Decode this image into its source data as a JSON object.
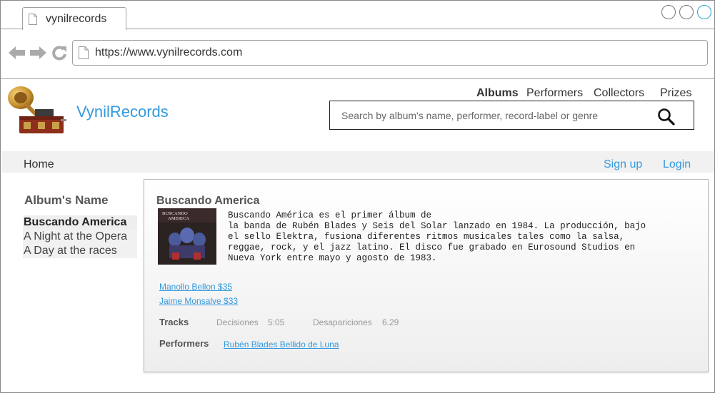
{
  "browser": {
    "tab_title": "vynilrecords",
    "url": "https://www.vynilrecords.com"
  },
  "site": {
    "brand": "VynilRecords",
    "nav": [
      "Albums",
      "Performers",
      "Collectors",
      "Prizes"
    ],
    "active_nav": "Albums",
    "search_placeholder": "Search by album's name, performer, record-label or genre"
  },
  "subnav": {
    "home": "Home",
    "signup": "Sign up",
    "login": "Login"
  },
  "sidebar": {
    "title": "Album's Name",
    "items": [
      {
        "label": "Buscando America",
        "selected": true
      },
      {
        "label": "A Night at the Opera",
        "selected": false
      },
      {
        "label": "A Day at the races",
        "selected": false
      }
    ]
  },
  "album": {
    "title": "Buscando America",
    "cover_text": "BUSCANDO AMERICA",
    "description": "Buscando América es el primer álbum de\nla banda de Rubén Blades y Seis del Solar lanzado en 1984. La producción, bajo\nel sello Elektra, fusiona diferentes ritmos musicales tales como la salsa,\nreggae, rock, y el jazz latino. El disco fue grabado en Eurosound Studios en\nNueva York entre mayo y agosto de 1983.",
    "collectors": [
      "Manollo Bellon  $35",
      "Jaime Monsalve  $33"
    ],
    "tracks_label": "Tracks",
    "tracks": [
      {
        "name": "Decisiones",
        "duration": "5:05"
      },
      {
        "name": "Desapariciones",
        "duration": "6.29"
      }
    ],
    "performers_label": "Performers",
    "performers": "Rubén Blades Bellido de Luna"
  },
  "colors": {
    "accent": "#3399dd",
    "subnav_bg": "#f1f1f1"
  },
  "icons": [
    "document-icon",
    "back-arrow-icon",
    "forward-arrow-icon",
    "reload-icon",
    "search-icon",
    "gramophone-logo"
  ]
}
